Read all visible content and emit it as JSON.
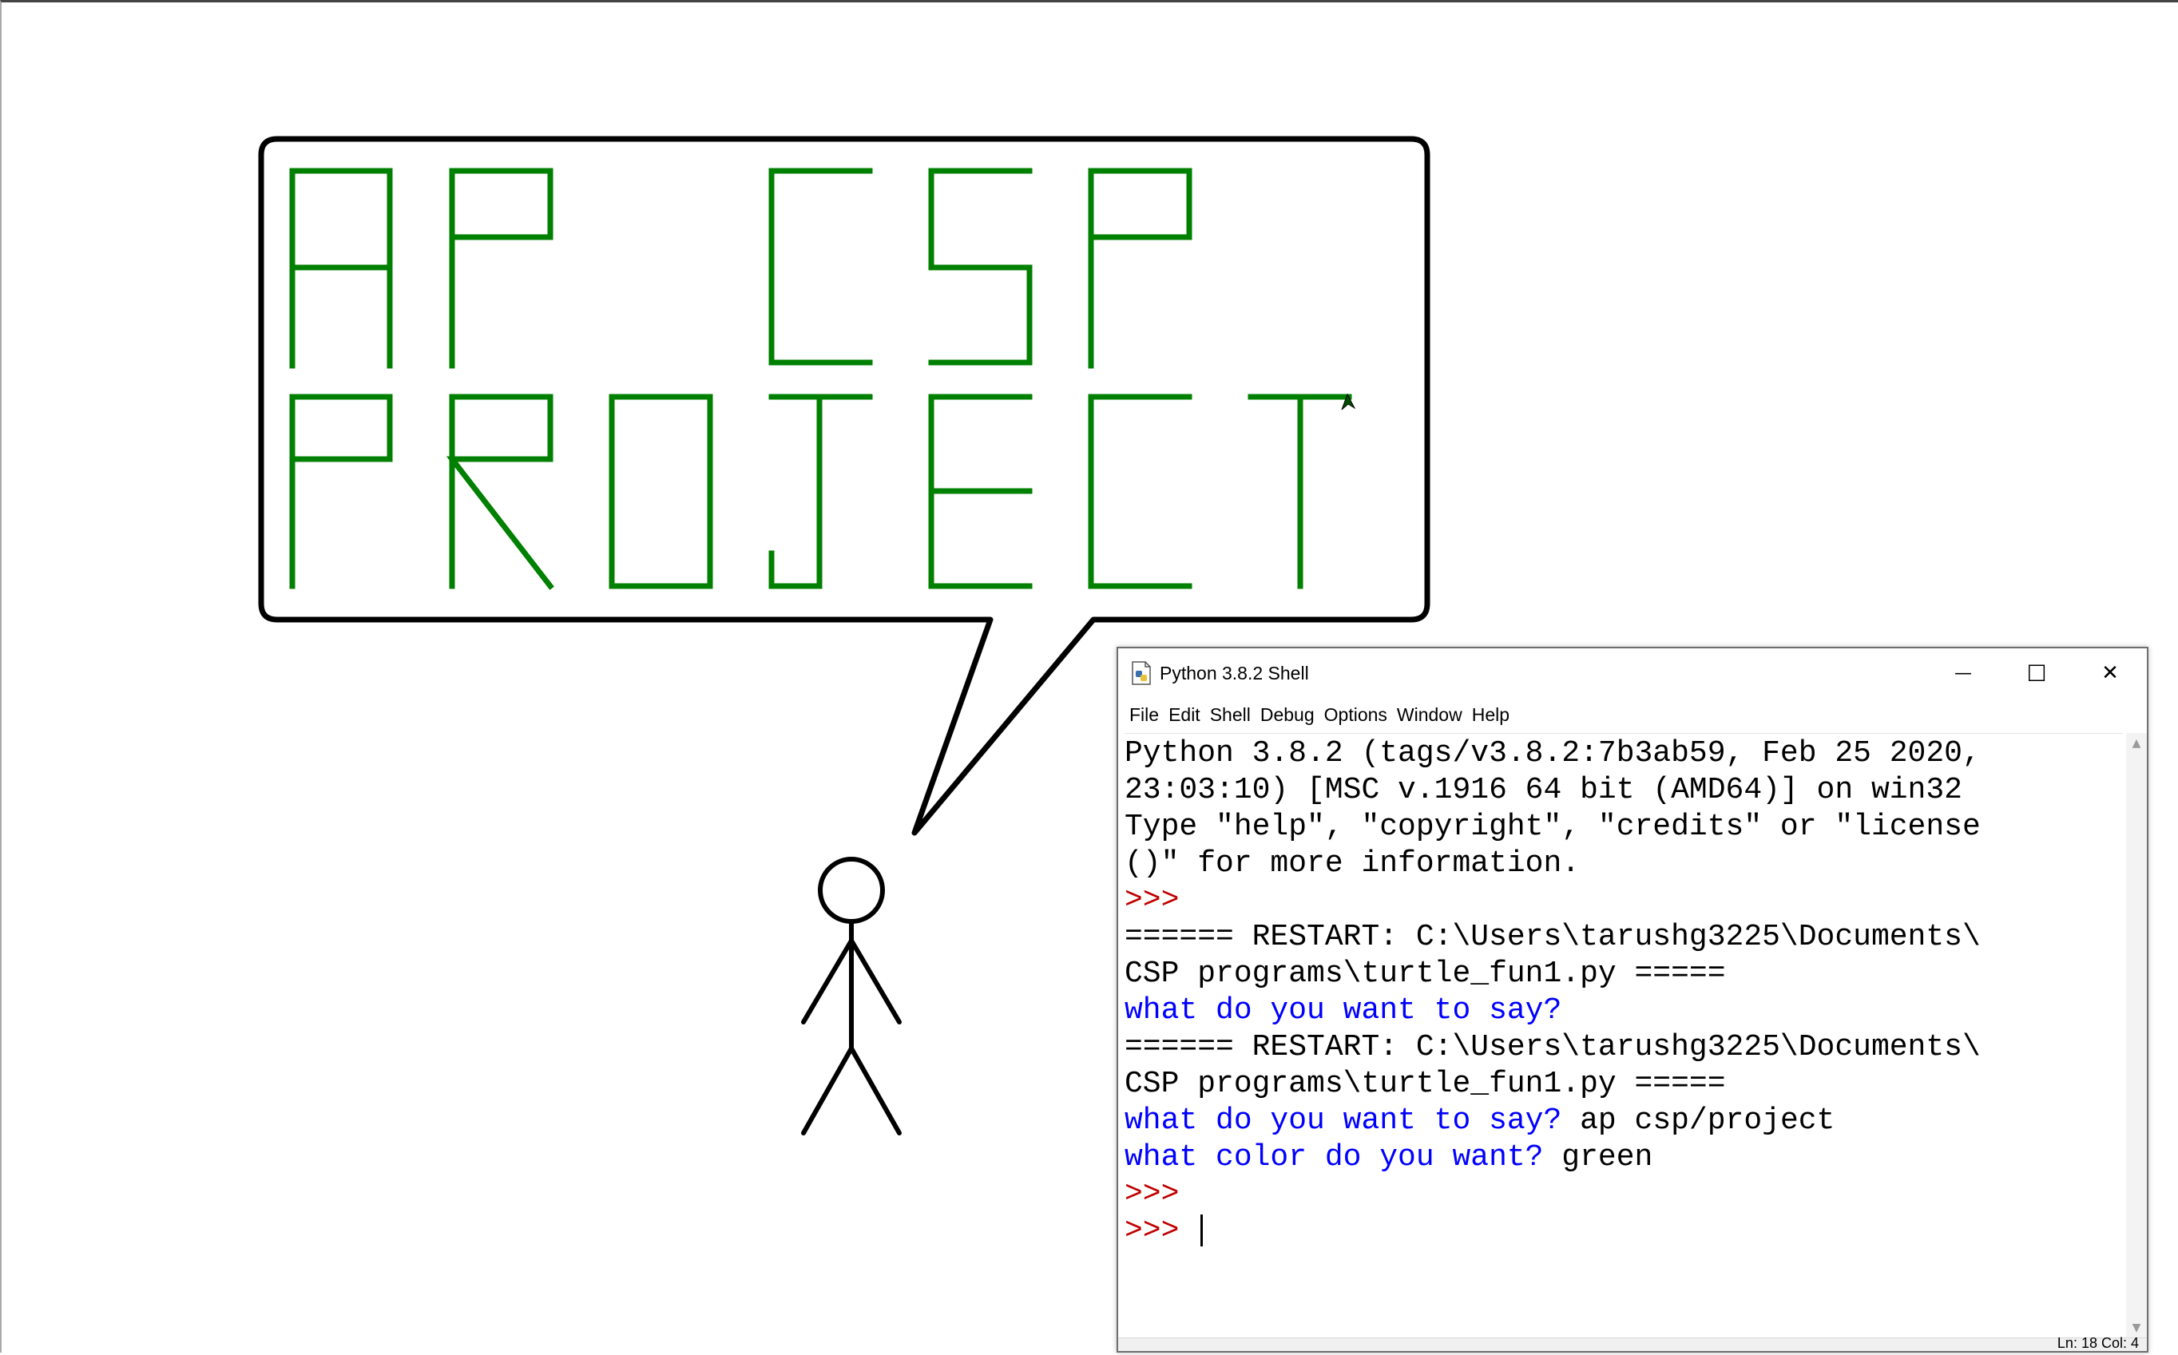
{
  "turtle_canvas": {
    "drawing_text": "AP CSP PROJECT",
    "pen_color": "#008000",
    "outline_color": "#000000"
  },
  "shell": {
    "title": "Python 3.8.2 Shell",
    "window_controls": {
      "minimize": "—",
      "maximize": "☐",
      "close": "✕"
    },
    "menu": [
      "File",
      "Edit",
      "Shell",
      "Debug",
      "Options",
      "Window",
      "Help"
    ],
    "lines": [
      {
        "type": "text",
        "text": "Python 3.8.2 (tags/v3.8.2:7b3ab59, Feb 25 2020,"
      },
      {
        "type": "text",
        "text": "23:03:10) [MSC v.1916 64 bit (AMD64)] on win32"
      },
      {
        "type": "text",
        "text": "Type \"help\", \"copyright\", \"credits\" or \"license"
      },
      {
        "type": "text",
        "text": "()\" for more information."
      },
      {
        "type": "prompt",
        "text": ">>>"
      },
      {
        "type": "text",
        "text": "====== RESTART: C:\\Users\\tarushg3225\\Documents\\"
      },
      {
        "type": "text",
        "text": "CSP programs\\turtle_fun1.py ====="
      },
      {
        "type": "stdout",
        "text": "what do you want to say?"
      },
      {
        "type": "text",
        "text": "====== RESTART: C:\\Users\\tarushg3225\\Documents\\"
      },
      {
        "type": "text",
        "text": "CSP programs\\turtle_fun1.py ====="
      },
      {
        "type": "io",
        "prompt": "what do you want to say?",
        "input": " ap csp/project"
      },
      {
        "type": "io",
        "prompt": "what color do you want?",
        "input": " green"
      },
      {
        "type": "prompt",
        "text": ">>>"
      },
      {
        "type": "prompt-cursor",
        "text": ">>> "
      }
    ],
    "status": "Ln: 18  Col: 4",
    "colors": {
      "prompt": "#c00000",
      "stdout": "#0000ff",
      "stdin": "#000000"
    }
  }
}
